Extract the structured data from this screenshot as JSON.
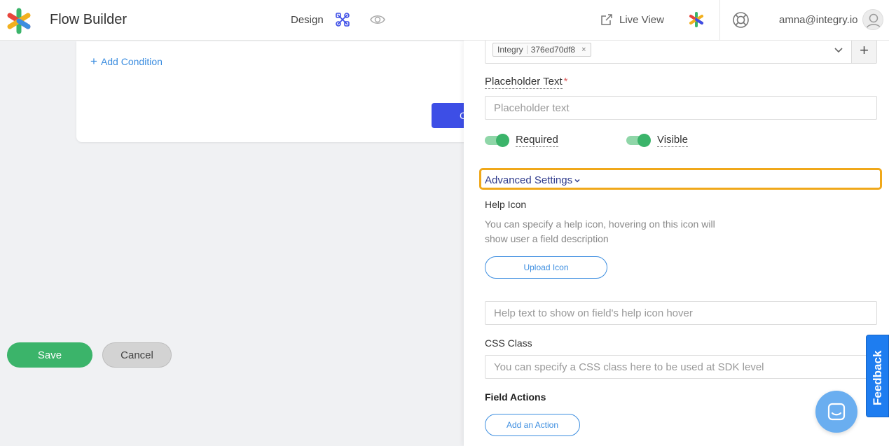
{
  "header": {
    "app_title": "Flow Builder",
    "tab_design": "Design",
    "live_view": "Live View",
    "user_email": "amna@integry.io"
  },
  "canvas": {
    "add_condition": "Add Condition",
    "hidden_button_label": "C",
    "save_label": "Save",
    "cancel_label": "Cancel"
  },
  "panel": {
    "select": {
      "tag_name": "Integry",
      "tag_id": "376ed70df8"
    },
    "placeholder_label": "Placeholder Text",
    "placeholder_input_placeholder": "Placeholder text",
    "required_label": "Required",
    "visible_label": "Visible",
    "advanced_label": "Advanced Settings",
    "help_icon_label": "Help Icon",
    "help_icon_desc": "You can specify a help icon, hovering on this icon will show user a field description",
    "upload_icon": "Upload Icon",
    "help_text_placeholder": "Help text to show on field's help icon hover",
    "css_class_label": "CSS Class",
    "css_class_placeholder": "You can specify a CSS class here to be used at SDK level",
    "field_actions_label": "Field Actions",
    "add_action": "Add an Action"
  },
  "feedback_label": "Feedback",
  "colors": {
    "accent_blue": "#3d8ee0",
    "save_green": "#3bb46a",
    "focus_orange": "#f0a81a",
    "feedback_blue": "#1e7df0"
  }
}
